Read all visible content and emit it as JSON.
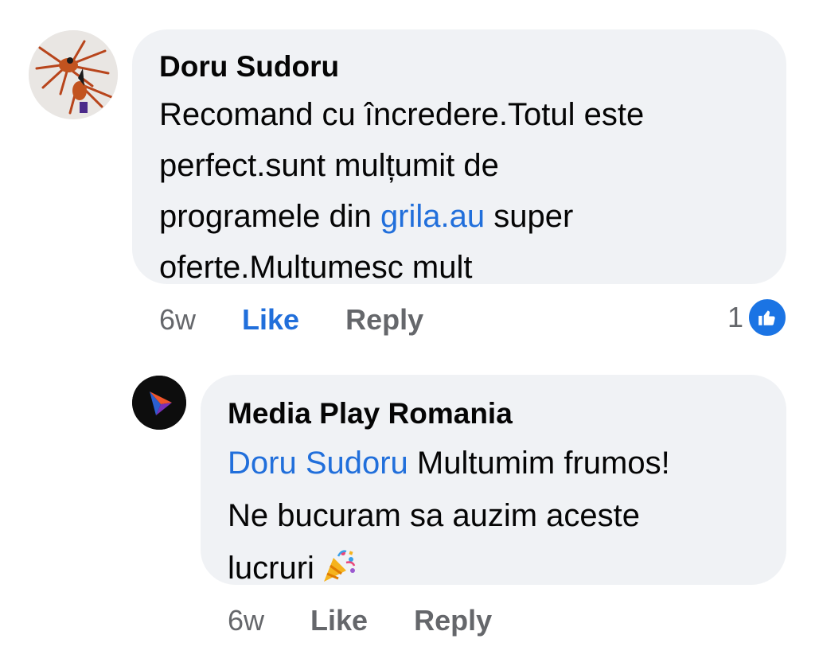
{
  "comments": [
    {
      "author": "Doru Sudoru",
      "lines": [
        {
          "text": "Recomand cu încredere.Totul este"
        },
        {
          "text": "perfect.sunt mulțumit de"
        },
        {
          "pre": "programele din ",
          "link": "grila.au",
          "post": " super"
        },
        {
          "text": "oferte.Multumesc mult"
        }
      ],
      "time": "6w",
      "like_label": "Like",
      "reply_label": "Reply",
      "reaction_count": "1",
      "reaction_icon": "thumbs-up-icon",
      "avatar_icon": "spider-avatar"
    },
    {
      "author": "Media Play Romania",
      "lines": [
        {
          "link": "Doru Sudoru",
          "post": " Multumim frumos!"
        },
        {
          "text": "Ne bucuram sa auzim aceste"
        },
        {
          "text": "lucruri",
          "emoji": "party-popper-icon"
        }
      ],
      "time": "6w",
      "like_label": "Like",
      "reply_label": "Reply",
      "avatar_icon": "play-logo-avatar"
    }
  ],
  "colors": {
    "link": "#216fdb",
    "bubble": "#f0f2f5",
    "meta": "#65676b",
    "like_badge": "#1b74e4"
  }
}
